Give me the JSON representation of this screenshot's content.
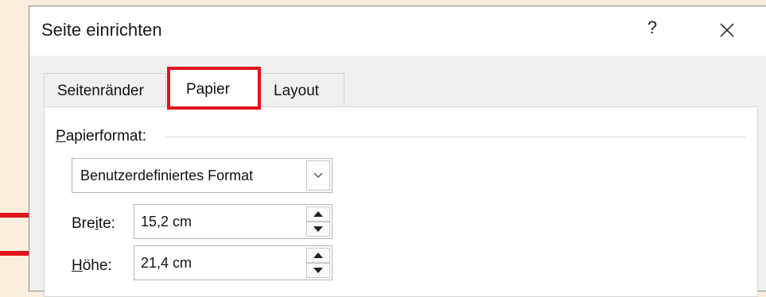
{
  "dialog": {
    "title": "Seite einrichten",
    "help_label": "?"
  },
  "tabs": [
    {
      "label": "Seitenränder",
      "selected": false
    },
    {
      "label": "Papier",
      "selected": true
    },
    {
      "label": "Layout",
      "selected": false
    }
  ],
  "paper_format": {
    "group_label_first": "P",
    "group_label_rest": "apierformat:",
    "selected_value": "Benutzerdefiniertes Format"
  },
  "width": {
    "label_before": "Bre",
    "label_accel": "i",
    "label_after": "te:",
    "value": "15,2 cm"
  },
  "height": {
    "label_accel": "H",
    "label_after": "öhe:",
    "value": "21,4 cm"
  },
  "colors": {
    "highlight": "#e2141c",
    "annotation_arrow": "#e2141c",
    "background": "#fbeedc"
  }
}
